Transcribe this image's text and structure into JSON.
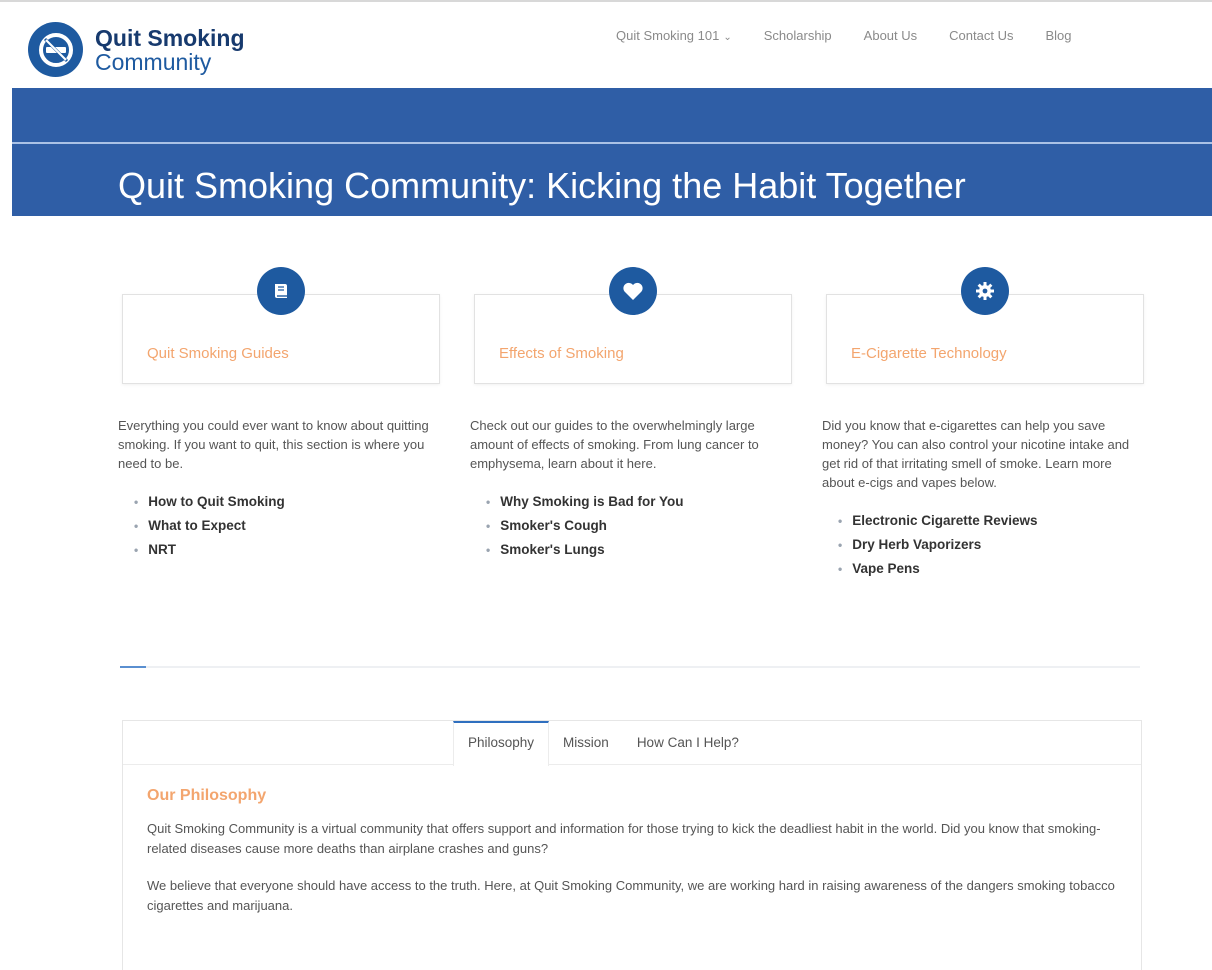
{
  "brand": {
    "line1": "Quit Smoking",
    "line2": "Community"
  },
  "nav": {
    "items": [
      {
        "label": "Quit Smoking 101",
        "has_dropdown": true
      },
      {
        "label": "Scholarship"
      },
      {
        "label": "About Us"
      },
      {
        "label": "Contact Us"
      },
      {
        "label": "Blog"
      }
    ]
  },
  "banner": {
    "title": "Quit Smoking Community: Kicking the Habit Together"
  },
  "features": [
    {
      "icon": "book-icon",
      "title": "Quit Smoking Guides",
      "description": "Everything you could ever want to know about quitting smoking. If you want to quit, this section is where you need to be.",
      "links": [
        "How to Quit Smoking",
        "What to Expect",
        "NRT"
      ]
    },
    {
      "icon": "heart-icon",
      "title": "Effects of Smoking",
      "description": "Check out our guides to the overwhelmingly large amount of effects of smoking. From lung cancer to emphysema, learn about it here.",
      "links": [
        "Why Smoking is Bad for You",
        "Smoker's Cough",
        "Smoker's Lungs"
      ]
    },
    {
      "icon": "gear-icon",
      "title": "E-Cigarette Technology",
      "description": "Did you know that e-cigarettes can help you save money? You can also control your nicotine intake and get rid of that irritating smell of smoke. Learn more about e-cigs and vapes below.",
      "links": [
        "Electronic Cigarette Reviews",
        "Dry Herb Vaporizers",
        "Vape Pens"
      ]
    }
  ],
  "tabs": {
    "items": [
      "Philosophy",
      "Mission",
      "How Can I Help?"
    ],
    "active": "Philosophy",
    "heading": "Our Philosophy",
    "paragraphs": [
      "Quit Smoking Community is a virtual community that offers support and information for those trying to kick the deadliest habit in the world. Did you know that smoking-related diseases cause more deaths than airplane crashes and guns?",
      "We believe that everyone should have access to the truth. Here, at Quit Smoking Community, we are working hard in raising awareness of the dangers smoking tobacco cigarettes and marijuana."
    ]
  },
  "colors": {
    "brand_blue": "#1e5aa0",
    "banner_blue": "#2f5ea6",
    "accent_orange": "#f3a56e"
  }
}
